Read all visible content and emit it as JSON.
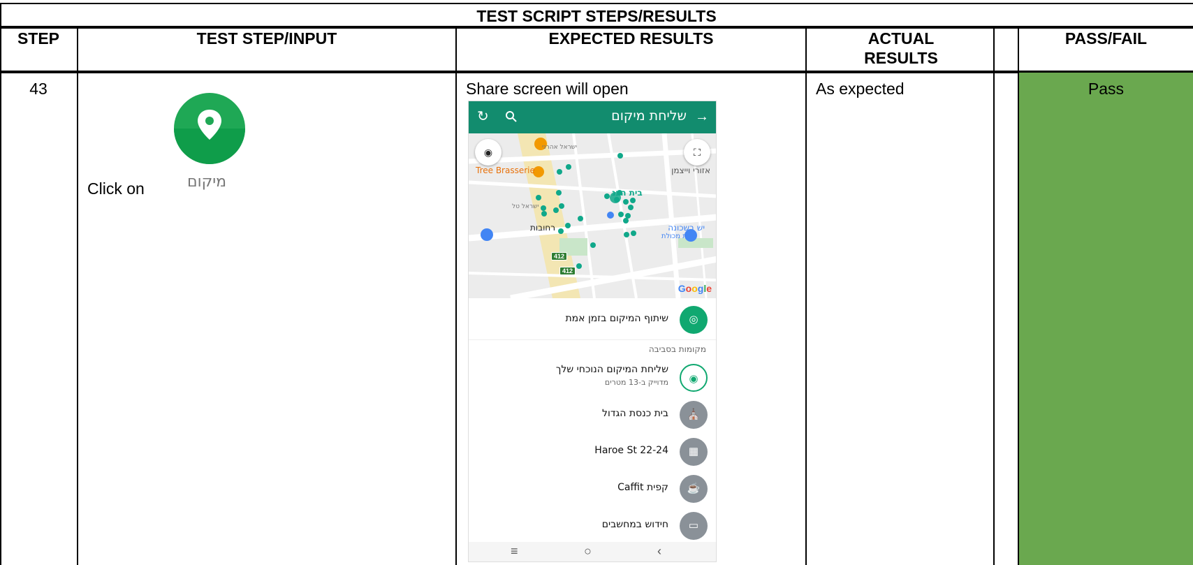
{
  "table": {
    "banner": "TEST SCRIPT STEPS/RESULTS",
    "headers": {
      "step": "STEP",
      "input": "TEST STEP/INPUT",
      "expected": "EXPECTED RESULTS",
      "actual": "ACTUAL RESULTS",
      "passfail": "PASS/FAIL"
    },
    "row": {
      "step": "43",
      "input_text": "Click on",
      "icon_label": "מיקום",
      "expected_text": "Share screen will open",
      "actual": "As expected",
      "result": "Pass",
      "result_color": "#6aa84f"
    }
  },
  "phone": {
    "title": "שליחת מיקום",
    "accent": "#128c6e",
    "map_labels": {
      "restaurant": "Tree Brasserie",
      "weizman": "אזורי וייצמן",
      "synagogue": "בית הכנ",
      "street1": "ישראל אהרני",
      "street2": "ישראל טל",
      "rehovot": "רחובות",
      "shop": "יש בשכונה",
      "shop_sub": "חנות מכולת",
      "road": "412",
      "google": "Google"
    },
    "live_share": "שיתוף המיקום בזמן אמת",
    "section": "מקומות בסביבה",
    "current": {
      "title": "שליחת המיקום הנוכחי שלך",
      "sub": "מדוייק ב-13 מטרים"
    },
    "places": [
      {
        "name": "בית כנסת הגדול"
      },
      {
        "name": "Haroe St 22-24"
      },
      {
        "name": "קפית Caffit"
      },
      {
        "name": "חידוש במחשבים"
      }
    ]
  }
}
